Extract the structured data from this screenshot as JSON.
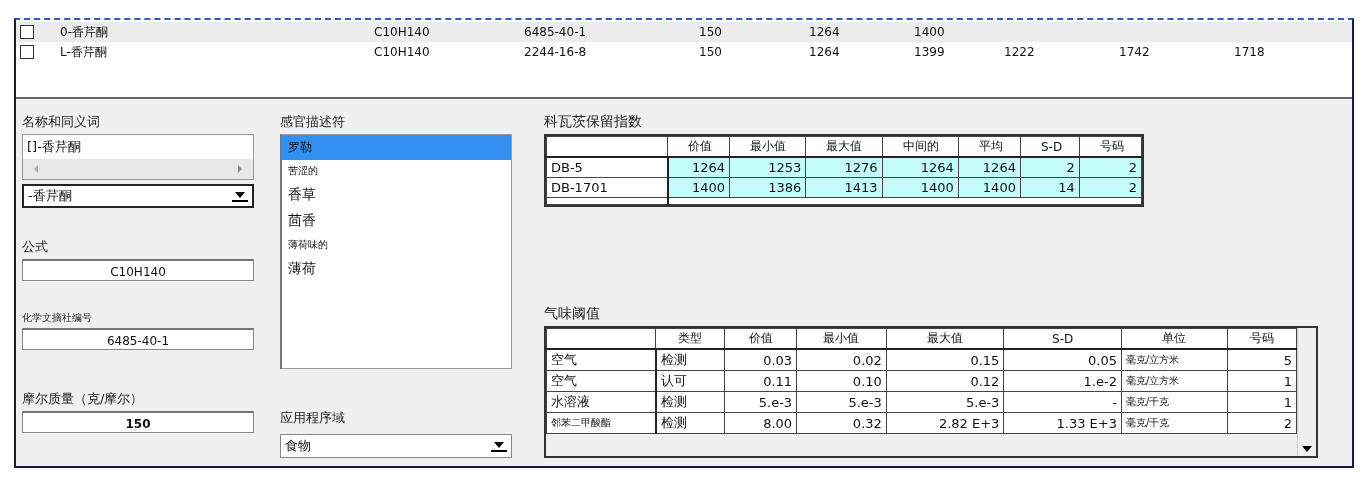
{
  "compounds": [
    {
      "checked": false,
      "selected": true,
      "name": "0-香芹酮",
      "cells": [
        "C10H140",
        "6485-40-1",
        "150",
        "1264",
        "1400"
      ]
    },
    {
      "checked": false,
      "selected": false,
      "name": "L-香芹酮",
      "cells": [
        "C10H140",
        "2244-16-8",
        "150",
        "1264",
        "1399",
        "1222",
        "1742",
        "1718"
      ]
    }
  ],
  "names": {
    "label": "名称和同义词",
    "items": [
      "[]-香芹酮"
    ],
    "combo_value": "-香芹酮"
  },
  "formula": {
    "label": "公式",
    "value": "C10H140"
  },
  "cas": {
    "label": "化学文摘社编号",
    "value": "6485-40-1"
  },
  "molar_mass": {
    "label": "摩尔质量（克/摩尔）",
    "value": "150"
  },
  "descriptors": {
    "label": "感官描述符",
    "items": [
      {
        "text": "罗勒",
        "selected": true
      },
      {
        "text": "苦涩的",
        "selected": false
      },
      {
        "text": "香草",
        "selected": false
      },
      {
        "text": "茴香",
        "selected": false
      },
      {
        "text": "薄荷味的",
        "selected": false
      },
      {
        "text": "薄荷",
        "selected": false
      }
    ]
  },
  "application": {
    "label": "应用程序域",
    "value": "食物"
  },
  "kovats": {
    "title": "科瓦茨保留指数",
    "columns": [
      "价值",
      "最小值",
      "最大值",
      "中间的",
      "平均",
      "S-D",
      "号码"
    ],
    "rows": [
      {
        "name": "DB-5",
        "cells": [
          "1264",
          "1253",
          "1276",
          "1264",
          "1264",
          "2",
          "2"
        ]
      },
      {
        "name": "DB-1701",
        "cells": [
          "1400",
          "1386",
          "1413",
          "1400",
          "1400",
          "14",
          "2"
        ]
      }
    ]
  },
  "odor": {
    "title": "气味阈值",
    "columns": [
      "类型",
      "价值",
      "最小值",
      "最大值",
      "S-D",
      "单位",
      "号码"
    ],
    "rows": [
      {
        "name": "空气",
        "cells": [
          "检测",
          "0.03",
          "0.02",
          "0.15",
          "0.05",
          "毫克/立方米",
          "5"
        ]
      },
      {
        "name": "空气",
        "cells": [
          "认可",
          "0.11",
          "0.10",
          "0.12",
          "1.e-2",
          "毫克/立方米",
          "1"
        ]
      },
      {
        "name": "水溶液",
        "cells": [
          "检测",
          "5.e-3",
          "5.e-3",
          "5.e-3",
          "-",
          "毫克/千克",
          "1"
        ]
      },
      {
        "name": "邻苯二甲酸酯",
        "cells": [
          "检测",
          "8.00",
          "0.32",
          "2.82 E+3",
          "1.33 E+3",
          "毫克/千克",
          "2"
        ]
      }
    ]
  }
}
